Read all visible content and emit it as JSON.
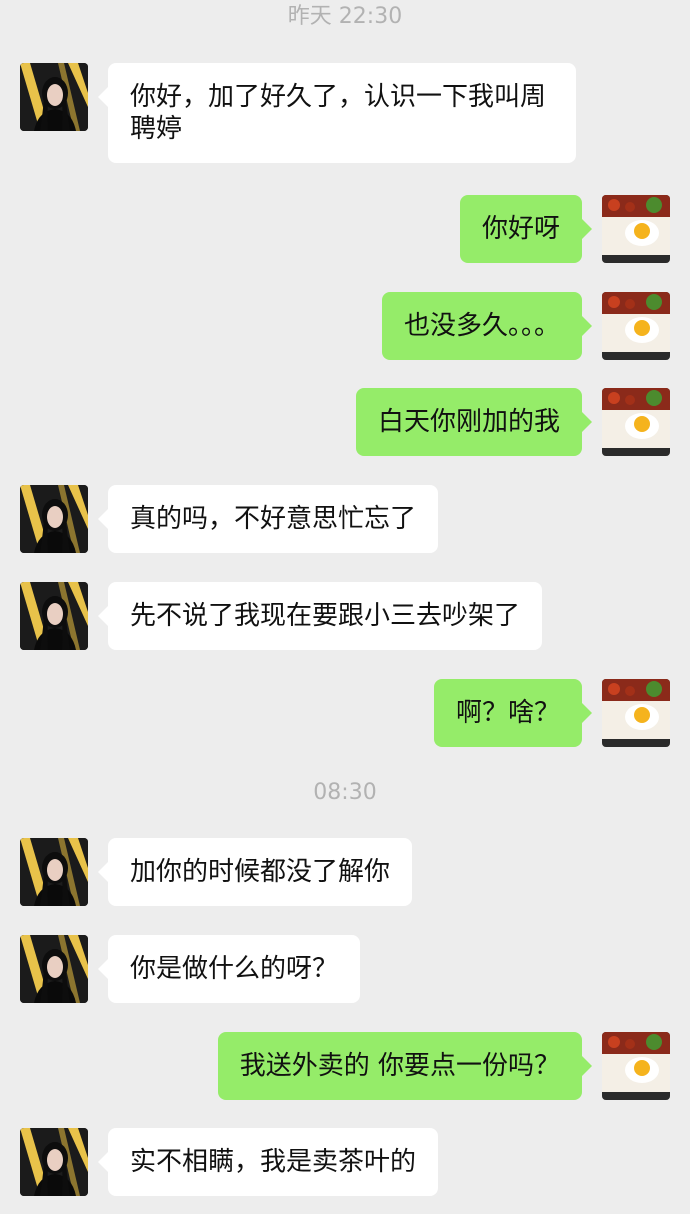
{
  "timestamps": [
    "昨天 22:30",
    "08:30"
  ],
  "colors": {
    "background": "#ededed",
    "incoming_bubble": "#ffffff",
    "outgoing_bubble": "#95ec69",
    "timestamp_text": "#b2b2b2"
  },
  "messages": [
    {
      "side": "left",
      "text": "你好，加了好久了，认识一下我叫周聘婷"
    },
    {
      "side": "right",
      "text": "你好呀"
    },
    {
      "side": "right",
      "text": "也没多久。。。"
    },
    {
      "side": "right",
      "text": "白天你刚加的我"
    },
    {
      "side": "left",
      "text": "真的吗，不好意思忙忘了"
    },
    {
      "side": "left",
      "text": "先不说了我现在要跟小三去吵架了"
    },
    {
      "side": "right",
      "text": "啊？啥？"
    },
    {
      "side": "left",
      "text": "加你的时候都没了解你"
    },
    {
      "side": "left",
      "text": "你是做什么的呀？"
    },
    {
      "side": "right",
      "text": "我送外卖的 你要点一份吗？"
    },
    {
      "side": "left",
      "text": "实不相瞒，我是卖茶叶的"
    }
  ],
  "icons": {
    "incoming_avatar": "woman-portrait-avatar",
    "outgoing_avatar": "fried-egg-rice-avatar"
  }
}
